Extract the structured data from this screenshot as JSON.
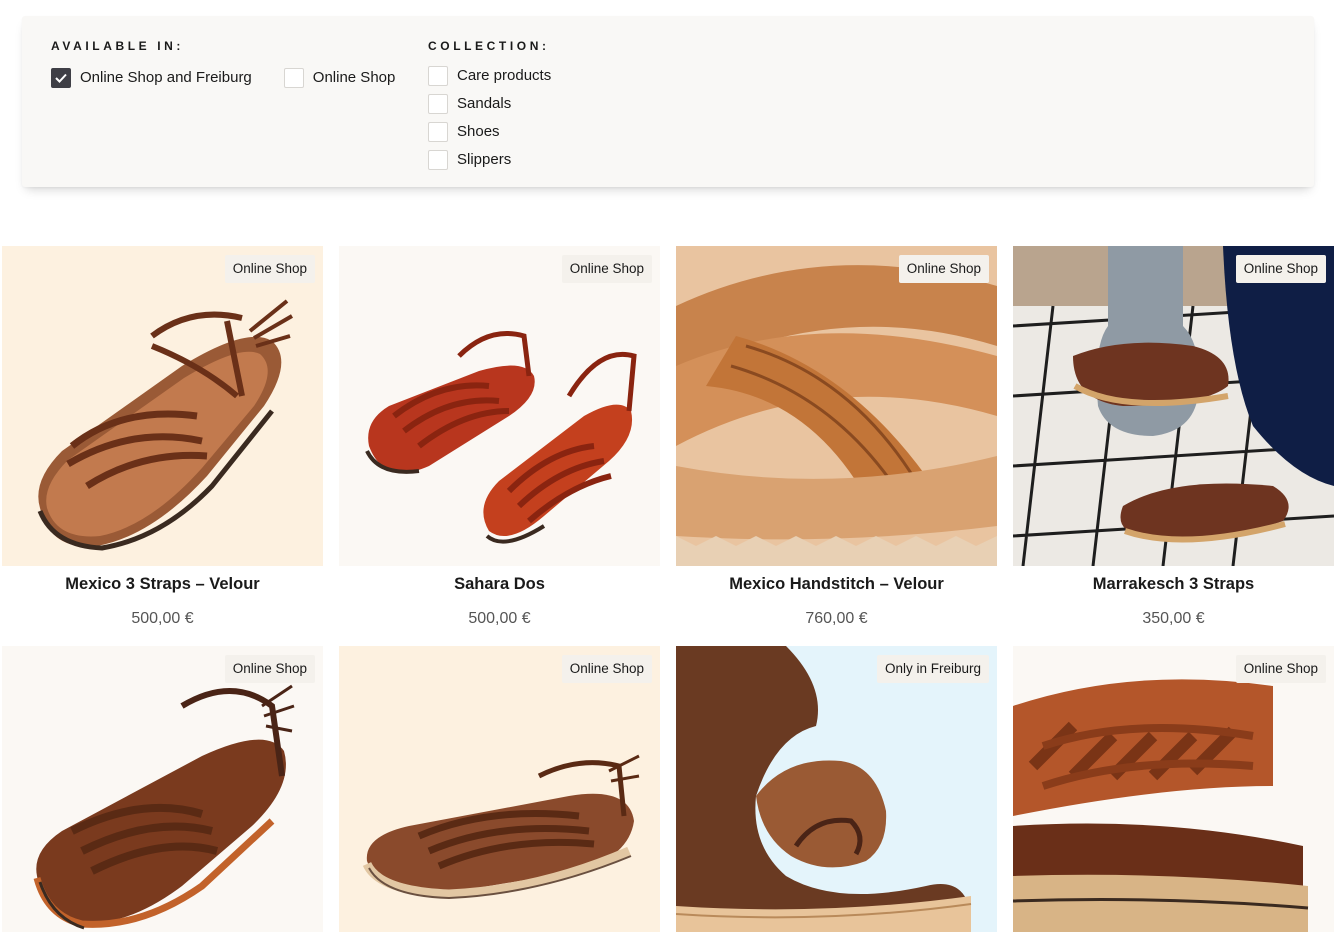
{
  "filters": {
    "available_heading": "AVAILABLE IN:",
    "available_options": [
      {
        "label": "Online Shop and Freiburg",
        "checked": true
      },
      {
        "label": "Online Shop",
        "checked": false
      }
    ],
    "collection_heading": "COLLECTION:",
    "collection_options": [
      {
        "label": "Care products",
        "checked": false
      },
      {
        "label": "Sandals",
        "checked": false
      },
      {
        "label": "Shoes",
        "checked": false
      },
      {
        "label": "Slippers",
        "checked": false
      }
    ]
  },
  "products": [
    {
      "name": "Mexico 3 Straps – Velour",
      "price": "500,00 €",
      "badge": "Online Shop",
      "bg": "#fdf1e0",
      "icon": "sandal-image"
    },
    {
      "name": "Sahara Dos",
      "price": "500,00 €",
      "badge": "Online Shop",
      "bg": "#fbf8f4",
      "icon": "sandal-pair-image"
    },
    {
      "name": "Mexico Handstitch – Velour",
      "price": "760,00 €",
      "badge": "Online Shop",
      "bg": "#c97a44",
      "icon": "sandal-closeup-image"
    },
    {
      "name": "Marrakesch 3 Straps",
      "price": "350,00 €",
      "badge": "Online Shop",
      "bg": "#e9e6e1",
      "icon": "slipper-lifestyle-image"
    },
    {
      "name": "",
      "price": "",
      "badge": "Online Shop",
      "bg": "#fbf8f4",
      "icon": "sandal-image"
    },
    {
      "name": "",
      "price": "",
      "badge": "Online Shop",
      "bg": "#fdf1e0",
      "icon": "sandal-image"
    },
    {
      "name": "",
      "price": "",
      "badge": "Only in Freiburg",
      "bg": "#e4f4fb",
      "icon": "shoe-closeup-image"
    },
    {
      "name": "",
      "price": "",
      "badge": "Online Shop",
      "bg": "#fbf8f4",
      "icon": "sandal-closeup-image"
    }
  ],
  "colors": {
    "panel_bg": "#f9f8f6",
    "checkbox_checked": "#3f3f46",
    "badge_bg": "#f4f1ec",
    "price_text": "#555555"
  }
}
